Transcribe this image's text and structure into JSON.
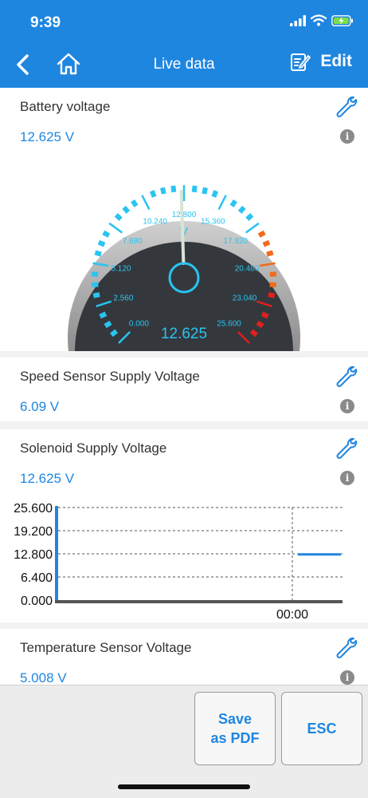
{
  "status_bar": {
    "time": "9:39"
  },
  "nav": {
    "title": "Live data",
    "edit_label": "Edit"
  },
  "cards": [
    {
      "title": "Battery voltage",
      "value": "12.625 V"
    },
    {
      "title": "Speed Sensor Supply Voltage",
      "value": "6.09 V"
    },
    {
      "title": "Solenoid Supply Voltage",
      "value": "12.625 V"
    },
    {
      "title": "Temperature Sensor Voltage",
      "value": "5.008 V"
    }
  ],
  "gauge": {
    "unit": "V",
    "reading": "12.625",
    "value": 12.625,
    "min": 0,
    "max": 25.6,
    "tick_labels": [
      "0.000",
      "2.560",
      "5.120",
      "7.680",
      "10.240",
      "12.800",
      "15.360",
      "17.920",
      "20.480",
      "23.040",
      "25.600"
    ]
  },
  "chart_data": {
    "type": "line",
    "ylim": [
      0,
      25.6
    ],
    "y_ticks": [
      "25.600",
      "19.200",
      "12.800",
      "6.400",
      "0.000"
    ],
    "x_ticks": [
      "00:00"
    ],
    "series": [
      {
        "values": [
          12.625,
          12.625
        ]
      }
    ]
  },
  "buttons": {
    "save_pdf_line1": "Save",
    "save_pdf_line2": "as PDF",
    "esc": "ESC"
  },
  "colors": {
    "accent": "#1f86e0",
    "gauge_cyan": "#29c4f0",
    "gauge_orange": "#f26a1b",
    "gauge_red": "#e0201c"
  }
}
